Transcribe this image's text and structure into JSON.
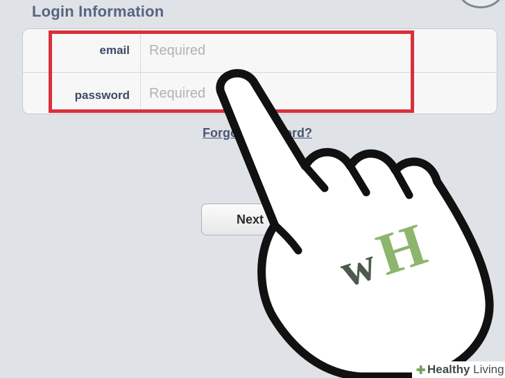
{
  "section": {
    "title": "Login Information"
  },
  "form": {
    "email": {
      "label": "email",
      "placeholder": "Required"
    },
    "password": {
      "label": "password",
      "placeholder": "Required"
    }
  },
  "links": {
    "forgot_password": "Forgot Password?"
  },
  "buttons": {
    "next": "Next"
  },
  "logo": {
    "text": "wH"
  },
  "watermark": {
    "bold": "Healthy",
    "rest": " Living"
  },
  "colors": {
    "background": "#dfe2e7",
    "highlight": "#d8303b",
    "label": "#3e4a66",
    "title": "#56657f",
    "logo_w": "#4b5a4a",
    "logo_h": "#8cb56d"
  }
}
